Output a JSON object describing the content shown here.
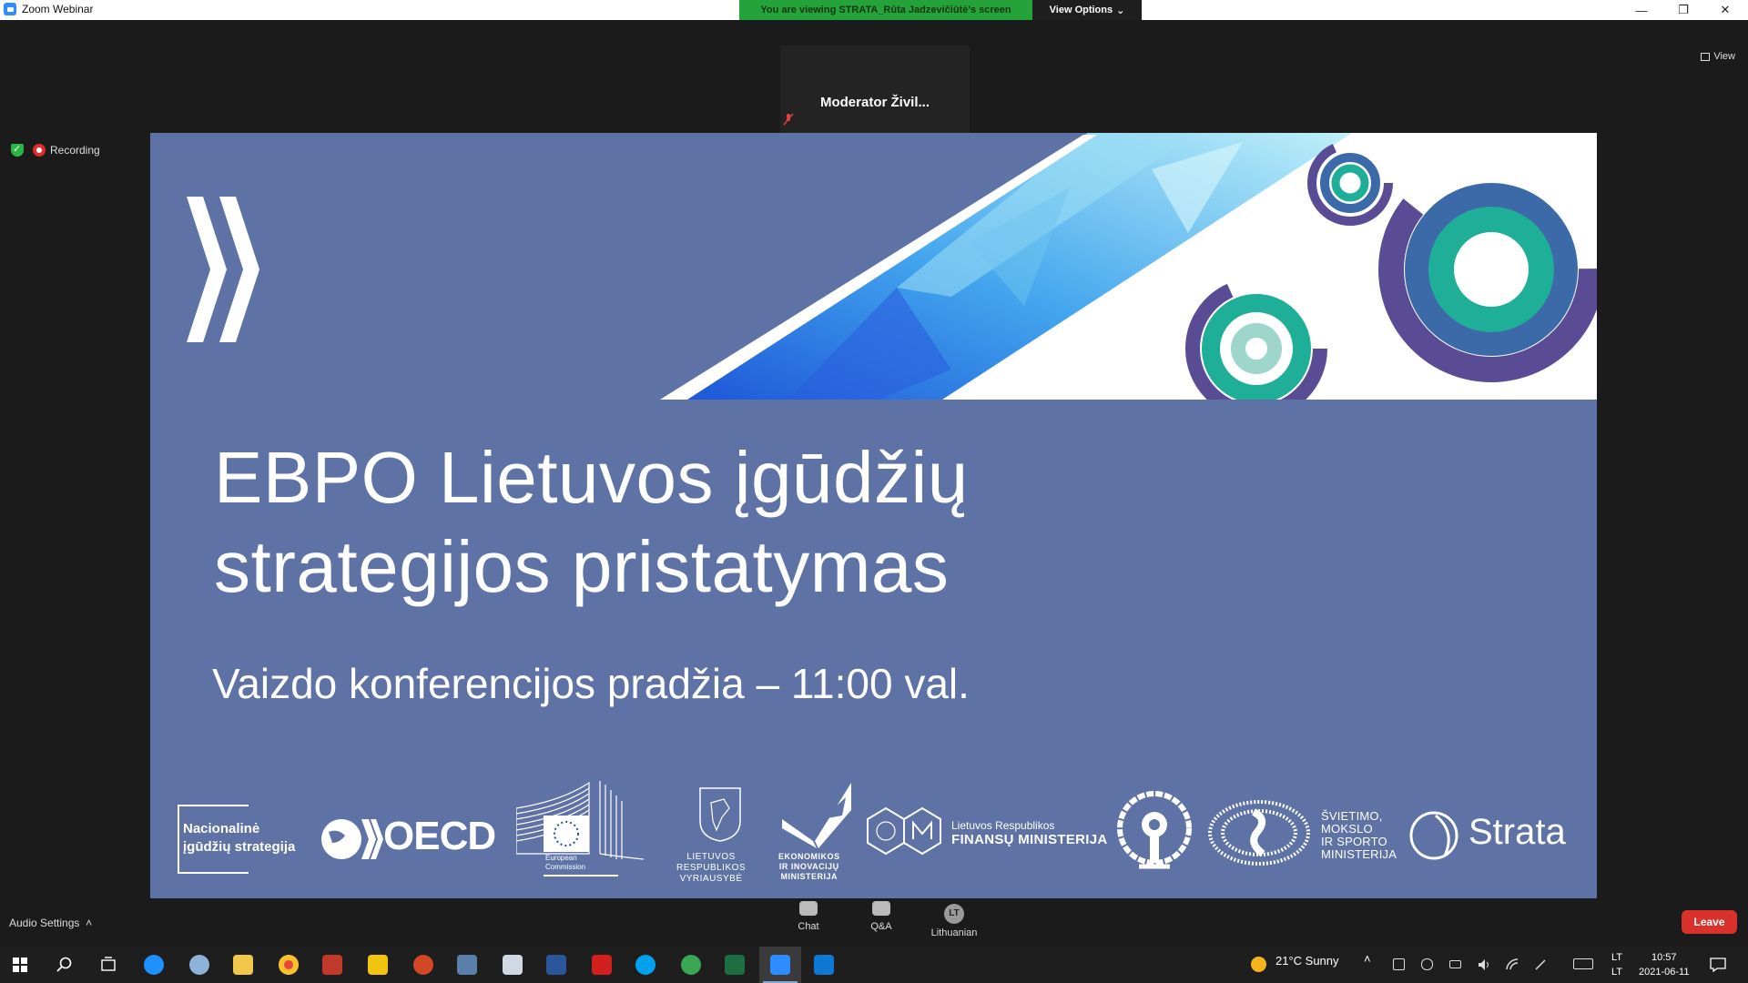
{
  "window": {
    "title": "Zoom Webinar"
  },
  "banner": {
    "viewing_text": "You are viewing STRATA_Rūta Jadzevičiūtė's screen",
    "view_options": "View Options"
  },
  "meeting": {
    "moderator_name": "Moderator  Živil...",
    "view_label": "View",
    "recording_label": "Recording"
  },
  "slide": {
    "title_line1": "EBPO Lietuvos įgūdžių",
    "title_line2": "strategijos pristatymas",
    "subtitle": "Vaizdo konferencijos pradžia – 11:00 val.",
    "logos": {
      "nis_line1": "Nacionalinė",
      "nis_line2": "įgūdžių strategija",
      "oecd": "OECD",
      "eu_line1": "European",
      "eu_line2": "Commission",
      "lrv_line1": "LIETUVOS",
      "lrv_line2": "RESPUBLIKOS",
      "lrv_line3": "VYRIAUSYBĖ",
      "eim_line1": "EKONOMIKOS",
      "eim_line2": "IR INOVACIJŲ",
      "eim_line3": "MINISTERIJA",
      "fm_line1": "Lietuvos Respublikos",
      "fm_line2": "FINANSŲ MINISTERIJA",
      "smsm_line1": "ŠVIETIMO,",
      "smsm_line2": "MOKSLO",
      "smsm_line3": "IR SPORTO",
      "smsm_line4": "MINISTERIJA",
      "strata": "Strata"
    },
    "colors": {
      "background": "#5f72a5",
      "teal": "#1fae98",
      "purple": "#5a4b95",
      "blue": "#3c6aa8"
    }
  },
  "controls": {
    "audio_settings": "Audio Settings",
    "chat": "Chat",
    "qa": "Q&A",
    "lang_badge": "LT",
    "language": "Lithuanian",
    "leave": "Leave"
  },
  "taskbar": {
    "weather": "21°C  Sunny",
    "lang_top": "LT",
    "lang_bottom": "LT",
    "time": "10:57",
    "date": "2021-06-11"
  }
}
